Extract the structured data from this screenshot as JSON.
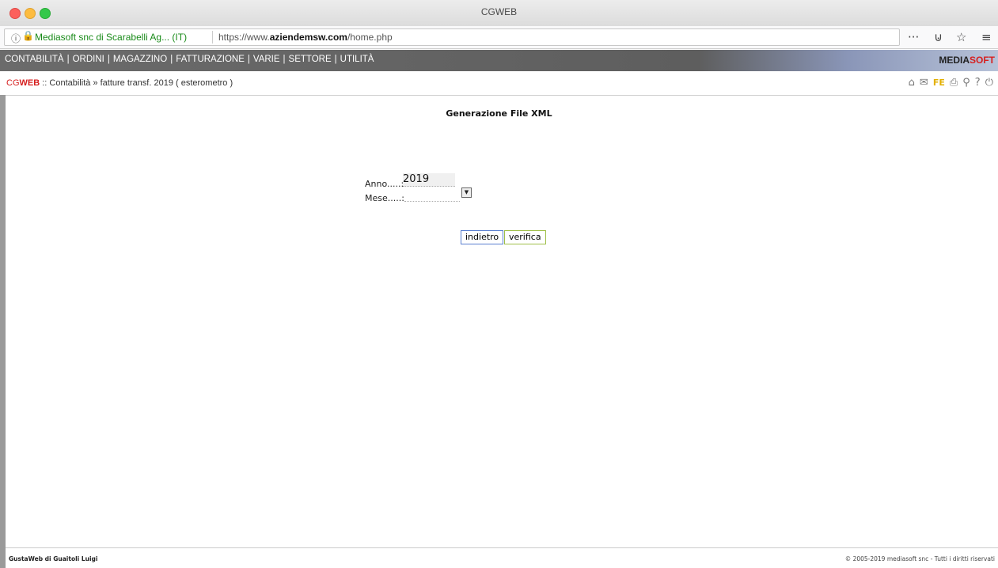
{
  "window": {
    "title": "CGWEB"
  },
  "browser": {
    "site_identity": "Mediasoft snc di Scarabelli Ag... (IT)",
    "url_prefix": "https://www.",
    "url_domain": "aziendemsw.com",
    "url_path": "/home.php"
  },
  "nav": {
    "items": [
      "CONTABILITÀ",
      "ORDINI",
      "MAGAZZINO",
      "FATTURAZIONE",
      "VARIE",
      "SETTORE",
      "UTILITÀ"
    ],
    "brand_a": "MEDIA",
    "brand_b": "SOFT"
  },
  "breadcrumb": {
    "app_a": "CG",
    "app_b": "WEB",
    "path": " :: Contabilità » fatture transf. 2019 ( esterometro )"
  },
  "toolbar_icons": {
    "fe": "FE"
  },
  "page": {
    "title": "Generazione File XML"
  },
  "form": {
    "anno_label": "Anno.....:",
    "anno_value": "2019",
    "mese_label": "Mese.....:",
    "mese_value": ""
  },
  "buttons": {
    "back": "indietro",
    "verify": "verifica"
  },
  "footer": {
    "left": "GustaWeb di Guaitoli Luigi",
    "right": "© 2005-2019 mediasoft snc - Tutti i diritti riservati"
  }
}
